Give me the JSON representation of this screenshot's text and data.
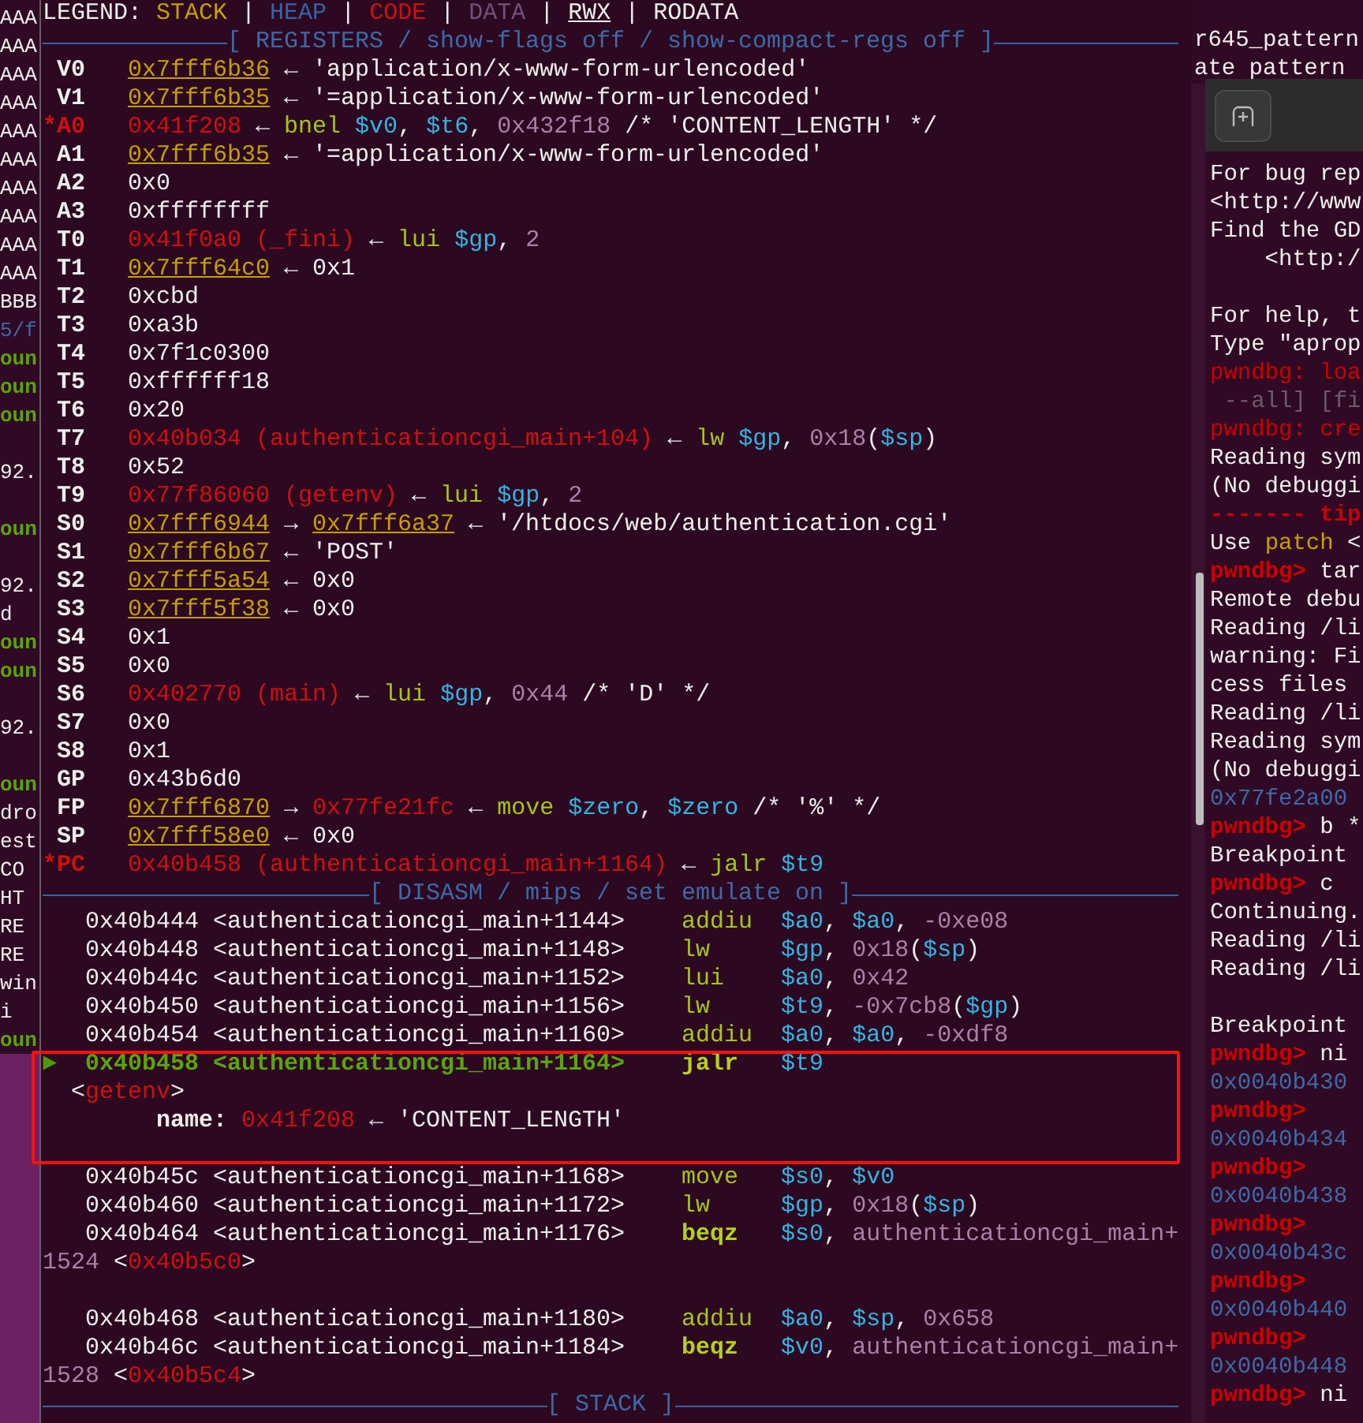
{
  "left_pane": {
    "lines": [
      {
        "text": "AAA",
        "kind": "plain"
      },
      {
        "text": "AAA",
        "kind": "plain"
      },
      {
        "text": "AAA",
        "kind": "plain"
      },
      {
        "text": "AAA",
        "kind": "plain"
      },
      {
        "text": "AAA",
        "kind": "plain"
      },
      {
        "text": "AAA",
        "kind": "plain"
      },
      {
        "text": "AAA",
        "kind": "plain"
      },
      {
        "text": "AAA",
        "kind": "plain"
      },
      {
        "text": "AAA",
        "kind": "plain"
      },
      {
        "text": "AAA",
        "kind": "plain"
      },
      {
        "text": "BBB",
        "kind": "plain"
      },
      {
        "text": "5/f",
        "kind": "blue"
      },
      {
        "text": "oun",
        "kind": "green"
      },
      {
        "text": "oun",
        "kind": "green"
      },
      {
        "text": "oun",
        "kind": "green"
      },
      {
        "kind": "blank"
      },
      {
        "text": "92.",
        "kind": "plain"
      },
      {
        "kind": "blank"
      },
      {
        "text": "oun",
        "kind": "green"
      },
      {
        "kind": "blank"
      },
      {
        "text": "92.",
        "kind": "plain"
      },
      {
        "text": "d",
        "kind": "plain"
      },
      {
        "text": "oun",
        "kind": "green"
      },
      {
        "text": "oun",
        "kind": "green"
      },
      {
        "kind": "blank"
      },
      {
        "text": "92.",
        "kind": "plain"
      },
      {
        "kind": "blank"
      },
      {
        "text": "oun",
        "kind": "green"
      },
      {
        "text": "dro",
        "kind": "plain"
      },
      {
        "text": "est",
        "kind": "plain"
      },
      {
        "text": "CO",
        "kind": "plain"
      },
      {
        "text": "HT",
        "kind": "plain"
      },
      {
        "text": "RE",
        "kind": "plain"
      },
      {
        "text": "RE",
        "kind": "plain"
      },
      {
        "text": "win",
        "kind": "plain"
      },
      {
        "text": "i",
        "kind": "plain"
      },
      {
        "text": "oun",
        "kind": "green"
      }
    ]
  },
  "main_pane": {
    "legend": [
      {
        "text": "LEGEND: ",
        "kind": "plain"
      },
      {
        "text": "STACK",
        "kind": "stack-label"
      },
      {
        "text": " | ",
        "kind": "plain"
      },
      {
        "text": "HEAP",
        "kind": "heap"
      },
      {
        "text": " | ",
        "kind": "plain"
      },
      {
        "text": "CODE",
        "kind": "code"
      },
      {
        "text": " | ",
        "kind": "plain"
      },
      {
        "text": "DATA",
        "kind": "data"
      },
      {
        "text": " | ",
        "kind": "plain"
      },
      {
        "text": "RWX",
        "kind": "rwx"
      },
      {
        "text": " | ",
        "kind": "plain"
      },
      {
        "text": "RODATA",
        "kind": "plain"
      }
    ],
    "registers": {
      "title": "[ REGISTERS / show-flags off / show-compact-regs off ]",
      "rows": [
        {
          "name": "V0",
          "changed": false,
          "value": [
            {
              "text": "0x7fff6b36",
              "kind": "stack"
            },
            {
              "text": " ← 'application/x-www-form-urlencoded'",
              "kind": "plain"
            }
          ]
        },
        {
          "name": "V1",
          "changed": false,
          "value": [
            {
              "text": "0x7fff6b35",
              "kind": "stack"
            },
            {
              "text": " ← '=application/x-www-form-urlencoded'",
              "kind": "plain"
            }
          ]
        },
        {
          "name": "*A0",
          "changed": true,
          "value": [
            {
              "text": "0x41f208",
              "kind": "code"
            },
            {
              "text": " ← ",
              "kind": "plain"
            },
            {
              "text": "bnel",
              "kind": "mnem"
            },
            {
              "text": " $v0",
              "kind": "reg"
            },
            {
              "text": ", ",
              "kind": "plain"
            },
            {
              "text": "$t6",
              "kind": "reg"
            },
            {
              "text": ", ",
              "kind": "plain"
            },
            {
              "text": "0x432f18",
              "kind": "num"
            },
            {
              "text": " /* 'CONTENT_LENGTH' */",
              "kind": "plain"
            }
          ]
        },
        {
          "name": "A1",
          "changed": false,
          "value": [
            {
              "text": "0x7fff6b35",
              "kind": "stack"
            },
            {
              "text": " ← '=application/x-www-form-urlencoded'",
              "kind": "plain"
            }
          ]
        },
        {
          "name": "A2",
          "changed": false,
          "value": [
            {
              "text": "0x0",
              "kind": "plain"
            }
          ]
        },
        {
          "name": "A3",
          "changed": false,
          "value": [
            {
              "text": "0xffffffff",
              "kind": "plain"
            }
          ]
        },
        {
          "name": "T0",
          "changed": false,
          "value": [
            {
              "text": "0x41f0a0 (_fini)",
              "kind": "code"
            },
            {
              "text": " ← ",
              "kind": "plain"
            },
            {
              "text": "lui",
              "kind": "mnem"
            },
            {
              "text": " $gp",
              "kind": "reg"
            },
            {
              "text": ", ",
              "kind": "plain"
            },
            {
              "text": "2",
              "kind": "num"
            }
          ]
        },
        {
          "name": "T1",
          "changed": false,
          "value": [
            {
              "text": "0x7fff64c0",
              "kind": "stack"
            },
            {
              "text": " ← 0x1",
              "kind": "plain"
            }
          ]
        },
        {
          "name": "T2",
          "changed": false,
          "value": [
            {
              "text": "0xcbd",
              "kind": "plain"
            }
          ]
        },
        {
          "name": "T3",
          "changed": false,
          "value": [
            {
              "text": "0xa3b",
              "kind": "plain"
            }
          ]
        },
        {
          "name": "T4",
          "changed": false,
          "value": [
            {
              "text": "0x7f1c0300",
              "kind": "plain"
            }
          ]
        },
        {
          "name": "T5",
          "changed": false,
          "value": [
            {
              "text": "0xffffff18",
              "kind": "plain"
            }
          ]
        },
        {
          "name": "T6",
          "changed": false,
          "value": [
            {
              "text": "0x20",
              "kind": "plain"
            }
          ]
        },
        {
          "name": "T7",
          "changed": false,
          "value": [
            {
              "text": "0x40b034 (authenticationcgi_main+104)",
              "kind": "code"
            },
            {
              "text": " ← ",
              "kind": "plain"
            },
            {
              "text": "lw",
              "kind": "mnem"
            },
            {
              "text": " $gp",
              "kind": "reg"
            },
            {
              "text": ", ",
              "kind": "plain"
            },
            {
              "text": "0x18",
              "kind": "num"
            },
            {
              "text": "(",
              "kind": "plain"
            },
            {
              "text": "$sp",
              "kind": "reg"
            },
            {
              "text": ")",
              "kind": "plain"
            }
          ]
        },
        {
          "name": "T8",
          "changed": false,
          "value": [
            {
              "text": "0x52",
              "kind": "plain"
            }
          ]
        },
        {
          "name": "T9",
          "changed": false,
          "value": [
            {
              "text": "0x77f86060 (getenv)",
              "kind": "code"
            },
            {
              "text": " ← ",
              "kind": "plain"
            },
            {
              "text": "lui",
              "kind": "mnem"
            },
            {
              "text": " $gp",
              "kind": "reg"
            },
            {
              "text": ", ",
              "kind": "plain"
            },
            {
              "text": "2",
              "kind": "num"
            }
          ]
        },
        {
          "name": "S0",
          "changed": false,
          "value": [
            {
              "text": "0x7fff6944",
              "kind": "stack"
            },
            {
              "text": " → ",
              "kind": "plain"
            },
            {
              "text": "0x7fff6a37",
              "kind": "stack"
            },
            {
              "text": " ← '/htdocs/web/authentication.cgi'",
              "kind": "plain"
            }
          ]
        },
        {
          "name": "S1",
          "changed": false,
          "value": [
            {
              "text": "0x7fff6b67",
              "kind": "stack"
            },
            {
              "text": " ← 'POST'",
              "kind": "plain"
            }
          ]
        },
        {
          "name": "S2",
          "changed": false,
          "value": [
            {
              "text": "0x7fff5a54",
              "kind": "stack"
            },
            {
              "text": " ← 0x0",
              "kind": "plain"
            }
          ]
        },
        {
          "name": "S3",
          "changed": false,
          "value": [
            {
              "text": "0x7fff5f38",
              "kind": "stack"
            },
            {
              "text": " ← 0x0",
              "kind": "plain"
            }
          ]
        },
        {
          "name": "S4",
          "changed": false,
          "value": [
            {
              "text": "0x1",
              "kind": "plain"
            }
          ]
        },
        {
          "name": "S5",
          "changed": false,
          "value": [
            {
              "text": "0x0",
              "kind": "plain"
            }
          ]
        },
        {
          "name": "S6",
          "changed": false,
          "value": [
            {
              "text": "0x402770 (main)",
              "kind": "code"
            },
            {
              "text": " ← ",
              "kind": "plain"
            },
            {
              "text": "lui",
              "kind": "mnem"
            },
            {
              "text": " $gp",
              "kind": "reg"
            },
            {
              "text": ", ",
              "kind": "plain"
            },
            {
              "text": "0x44",
              "kind": "num"
            },
            {
              "text": " /* 'D' */",
              "kind": "plain"
            }
          ]
        },
        {
          "name": "S7",
          "changed": false,
          "value": [
            {
              "text": "0x0",
              "kind": "plain"
            }
          ]
        },
        {
          "name": "S8",
          "changed": false,
          "value": [
            {
              "text": "0x1",
              "kind": "plain"
            }
          ]
        },
        {
          "name": "GP",
          "changed": false,
          "value": [
            {
              "text": "0x43b6d0",
              "kind": "plain"
            }
          ]
        },
        {
          "name": "FP",
          "changed": false,
          "value": [
            {
              "text": "0x7fff6870",
              "kind": "stack"
            },
            {
              "text": " → ",
              "kind": "plain"
            },
            {
              "text": "0x77fe21fc",
              "kind": "code"
            },
            {
              "text": " ← ",
              "kind": "plain"
            },
            {
              "text": "move",
              "kind": "mnem"
            },
            {
              "text": " $zero",
              "kind": "reg"
            },
            {
              "text": ", ",
              "kind": "plain"
            },
            {
              "text": "$zero",
              "kind": "reg"
            },
            {
              "text": " /* '%' */",
              "kind": "plain"
            }
          ]
        },
        {
          "name": "SP",
          "changed": false,
          "value": [
            {
              "text": "0x7fff58e0",
              "kind": "stack"
            },
            {
              "text": " ← 0x0",
              "kind": "plain"
            }
          ]
        },
        {
          "name": "*PC",
          "changed": true,
          "value": [
            {
              "text": "0x40b458 (authenticationcgi_main+1164)",
              "kind": "code"
            },
            {
              "text": " ← ",
              "kind": "plain"
            },
            {
              "text": "jalr",
              "kind": "mnem"
            },
            {
              "text": " $t9",
              "kind": "reg"
            }
          ]
        }
      ]
    },
    "disasm": {
      "title": "[ DISASM / mips / set emulate on ]",
      "lines": [
        {
          "kind": "instruction",
          "current": false,
          "address": "0x40b444 <authenticationcgi_main+1144>",
          "mnemonic": {
            "text": "addiu",
            "kind": "mnem"
          },
          "operands": [
            {
              "text": "$a0",
              "kind": "reg"
            },
            {
              "text": ", ",
              "kind": "plain"
            },
            {
              "text": "$a0",
              "kind": "reg"
            },
            {
              "text": ", ",
              "kind": "plain"
            },
            {
              "text": "-0xe08",
              "kind": "num"
            }
          ]
        },
        {
          "kind": "instruction",
          "current": false,
          "address": "0x40b448 <authenticationcgi_main+1148>",
          "mnemonic": {
            "text": "lw",
            "kind": "mnem"
          },
          "operands": [
            {
              "text": "$gp",
              "kind": "reg"
            },
            {
              "text": ", ",
              "kind": "plain"
            },
            {
              "text": "0x18",
              "kind": "num"
            },
            {
              "text": "(",
              "kind": "plain"
            },
            {
              "text": "$sp",
              "kind": "reg"
            },
            {
              "text": ")",
              "kind": "plain"
            }
          ]
        },
        {
          "kind": "instruction",
          "current": false,
          "address": "0x40b44c <authenticationcgi_main+1152>",
          "mnemonic": {
            "text": "lui",
            "kind": "mnem"
          },
          "operands": [
            {
              "text": "$a0",
              "kind": "reg"
            },
            {
              "text": ", ",
              "kind": "plain"
            },
            {
              "text": "0x42",
              "kind": "num"
            }
          ]
        },
        {
          "kind": "instruction",
          "current": false,
          "address": "0x40b450 <authenticationcgi_main+1156>",
          "mnemonic": {
            "text": "lw",
            "kind": "mnem"
          },
          "operands": [
            {
              "text": "$t9",
              "kind": "reg"
            },
            {
              "text": ", ",
              "kind": "plain"
            },
            {
              "text": "-0x7cb8",
              "kind": "num"
            },
            {
              "text": "(",
              "kind": "plain"
            },
            {
              "text": "$gp",
              "kind": "reg"
            },
            {
              "text": ")",
              "kind": "plain"
            }
          ]
        },
        {
          "kind": "instruction",
          "current": false,
          "address": "0x40b454 <authenticationcgi_main+1160>",
          "mnemonic": {
            "text": "addiu",
            "kind": "mnem"
          },
          "operands": [
            {
              "text": "$a0",
              "kind": "reg"
            },
            {
              "text": ", ",
              "kind": "plain"
            },
            {
              "text": "$a0",
              "kind": "reg"
            },
            {
              "text": ", ",
              "kind": "plain"
            },
            {
              "text": "-0xdf8",
              "kind": "num"
            }
          ]
        },
        {
          "kind": "instruction",
          "current": true,
          "marker": "►",
          "address": "0x40b458 <authenticationcgi_main+1164>",
          "mnemonic": {
            "text": "jalr",
            "kind": "branch"
          },
          "operands": [
            {
              "text": "$t9",
              "kind": "reg"
            }
          ]
        },
        {
          "kind": "call",
          "spans": [
            {
              "text": "<",
              "kind": "plain"
            },
            {
              "text": "getenv",
              "kind": "code"
            },
            {
              "text": ">",
              "kind": "plain"
            }
          ]
        },
        {
          "kind": "argument",
          "spans": [
            {
              "text": "name:",
              "kind": "bold"
            },
            {
              "text": " 0x41f208",
              "kind": "code"
            },
            {
              "text": " ← 'CONTENT_LENGTH'",
              "kind": "plain"
            }
          ]
        },
        {
          "kind": "blank"
        },
        {
          "kind": "instruction",
          "current": false,
          "address": "0x40b45c <authenticationcgi_main+1168>",
          "mnemonic": {
            "text": "move",
            "kind": "mnem"
          },
          "operands": [
            {
              "text": "$s0",
              "kind": "reg"
            },
            {
              "text": ", ",
              "kind": "plain"
            },
            {
              "text": "$v0",
              "kind": "reg"
            }
          ]
        },
        {
          "kind": "instruction",
          "current": false,
          "address": "0x40b460 <authenticationcgi_main+1172>",
          "mnemonic": {
            "text": "lw",
            "kind": "mnem"
          },
          "operands": [
            {
              "text": "$gp",
              "kind": "reg"
            },
            {
              "text": ", ",
              "kind": "plain"
            },
            {
              "text": "0x18",
              "kind": "num"
            },
            {
              "text": "(",
              "kind": "plain"
            },
            {
              "text": "$sp",
              "kind": "reg"
            },
            {
              "text": ")",
              "kind": "plain"
            }
          ]
        },
        {
          "kind": "instruction",
          "current": false,
          "address": "0x40b464 <authenticationcgi_main+1176>",
          "mnemonic": {
            "text": "beqz",
            "kind": "branch"
          },
          "operands": [
            {
              "text": "$s0",
              "kind": "reg"
            },
            {
              "text": ", ",
              "kind": "plain"
            },
            {
              "text": "authenticationcgi_main+",
              "kind": "num"
            }
          ]
        },
        {
          "kind": "continuation",
          "spans": [
            {
              "text": "1524",
              "kind": "num"
            },
            {
              "text": " <",
              "kind": "plain"
            },
            {
              "text": "0x40b5c0",
              "kind": "code"
            },
            {
              "text": ">",
              "kind": "plain"
            }
          ]
        },
        {
          "kind": "blank"
        },
        {
          "kind": "instruction",
          "current": false,
          "address": "0x40b468 <authenticationcgi_main+1180>",
          "mnemonic": {
            "text": "addiu",
            "kind": "mnem"
          },
          "operands": [
            {
              "text": "$a0",
              "kind": "reg"
            },
            {
              "text": ", ",
              "kind": "plain"
            },
            {
              "text": "$sp",
              "kind": "reg"
            },
            {
              "text": ", ",
              "kind": "plain"
            },
            {
              "text": "0x658",
              "kind": "num"
            }
          ]
        },
        {
          "kind": "instruction",
          "current": false,
          "address": "0x40b46c <authenticationcgi_main+1184>",
          "mnemonic": {
            "text": "beqz",
            "kind": "branch"
          },
          "operands": [
            {
              "text": "$v0",
              "kind": "reg"
            },
            {
              "text": ", ",
              "kind": "plain"
            },
            {
              "text": "authenticationcgi_main+",
              "kind": "num"
            }
          ]
        },
        {
          "kind": "continuation",
          "spans": [
            {
              "text": "1528",
              "kind": "num"
            },
            {
              "text": " <",
              "kind": "plain"
            },
            {
              "text": "0x40b5c4",
              "kind": "code"
            },
            {
              "text": ">",
              "kind": "plain"
            }
          ]
        }
      ]
    },
    "stack": {
      "title": "[ STACK ]"
    }
  },
  "right_pane": {
    "background_lines": [
      "r645_pattern",
      "ate pattern"
    ],
    "gdb_window": {
      "lines": [
        {
          "kind": "text",
          "spans": [
            {
              "text": "For bug rep",
              "kind": "plain"
            }
          ]
        },
        {
          "kind": "text",
          "spans": [
            {
              "text": "<http://www",
              "kind": "plain"
            }
          ]
        },
        {
          "kind": "text",
          "spans": [
            {
              "text": "Find the GD",
              "kind": "plain"
            }
          ]
        },
        {
          "kind": "indented",
          "spans": [
            {
              "text": "<http:/",
              "kind": "plain"
            }
          ]
        },
        {
          "kind": "blank"
        },
        {
          "kind": "text",
          "spans": [
            {
              "text": "For help, t",
              "kind": "plain"
            }
          ]
        },
        {
          "kind": "text",
          "spans": [
            {
              "text": "Type \"aprop",
              "kind": "plain"
            }
          ]
        },
        {
          "kind": "text",
          "spans": [
            {
              "text": "pwndbg: loa",
              "kind": "red"
            }
          ]
        },
        {
          "kind": "text",
          "spans": [
            {
              "text": " --all] [fi",
              "kind": "grey"
            }
          ]
        },
        {
          "kind": "text",
          "spans": [
            {
              "text": "pwndbg: cre",
              "kind": "red"
            }
          ]
        },
        {
          "kind": "text",
          "spans": [
            {
              "text": "Reading sym",
              "kind": "plain"
            }
          ]
        },
        {
          "kind": "text",
          "spans": [
            {
              "text": "(No debuggi",
              "kind": "plain"
            }
          ]
        },
        {
          "kind": "text",
          "spans": [
            {
              "text": "------- tip",
              "kind": "prompt"
            }
          ]
        },
        {
          "kind": "text",
          "spans": [
            {
              "text": "Use ",
              "kind": "plain"
            },
            {
              "text": "patch",
              "kind": "yellow"
            },
            {
              "text": " <",
              "kind": "plain"
            }
          ]
        },
        {
          "kind": "text",
          "spans": [
            {
              "text": "pwndbg>",
              "kind": "prompt"
            },
            {
              "text": " tar",
              "kind": "plain"
            }
          ]
        },
        {
          "kind": "text",
          "spans": [
            {
              "text": "Remote debu",
              "kind": "plain"
            }
          ]
        },
        {
          "kind": "text",
          "spans": [
            {
              "text": "Reading /li",
              "kind": "plain"
            }
          ]
        },
        {
          "kind": "text",
          "spans": [
            {
              "text": "warning: Fi",
              "kind": "plain"
            }
          ]
        },
        {
          "kind": "text",
          "spans": [
            {
              "text": "cess files",
              "kind": "plain"
            }
          ]
        },
        {
          "kind": "text",
          "spans": [
            {
              "text": "Reading /li",
              "kind": "plain"
            }
          ]
        },
        {
          "kind": "text",
          "spans": [
            {
              "text": "Reading sym",
              "kind": "plain"
            }
          ]
        },
        {
          "kind": "text",
          "spans": [
            {
              "text": "(No debuggi",
              "kind": "plain"
            }
          ]
        },
        {
          "kind": "text",
          "spans": [
            {
              "text": "0x77fe2a00",
              "kind": "blue"
            }
          ]
        },
        {
          "kind": "text",
          "spans": [
            {
              "text": "pwndbg>",
              "kind": "prompt"
            },
            {
              "text": " b *",
              "kind": "plain"
            }
          ]
        },
        {
          "kind": "text",
          "spans": [
            {
              "text": "Breakpoint",
              "kind": "plain"
            }
          ]
        },
        {
          "kind": "text",
          "spans": [
            {
              "text": "pwndbg>",
              "kind": "prompt"
            },
            {
              "text": " c",
              "kind": "plain"
            }
          ]
        },
        {
          "kind": "text",
          "spans": [
            {
              "text": "Continuing.",
              "kind": "plain"
            }
          ]
        },
        {
          "kind": "text",
          "spans": [
            {
              "text": "Reading /li",
              "kind": "plain"
            }
          ]
        },
        {
          "kind": "text",
          "spans": [
            {
              "text": "Reading /li",
              "kind": "plain"
            }
          ]
        },
        {
          "kind": "blank"
        },
        {
          "kind": "text",
          "spans": [
            {
              "text": "Breakpoint",
              "kind": "plain"
            }
          ]
        },
        {
          "kind": "text",
          "spans": [
            {
              "text": "pwndbg>",
              "kind": "prompt"
            },
            {
              "text": " ni",
              "kind": "plain"
            }
          ]
        },
        {
          "kind": "text",
          "spans": [
            {
              "text": "0x0040b430",
              "kind": "blue"
            }
          ]
        },
        {
          "kind": "text",
          "spans": [
            {
              "text": "pwndbg>",
              "kind": "prompt"
            }
          ]
        },
        {
          "kind": "text",
          "spans": [
            {
              "text": "0x0040b434",
              "kind": "blue"
            }
          ]
        },
        {
          "kind": "text",
          "spans": [
            {
              "text": "pwndbg>",
              "kind": "prompt"
            }
          ]
        },
        {
          "kind": "text",
          "spans": [
            {
              "text": "0x0040b438",
              "kind": "blue"
            }
          ]
        },
        {
          "kind": "text",
          "spans": [
            {
              "text": "pwndbg>",
              "kind": "prompt"
            }
          ]
        },
        {
          "kind": "text",
          "spans": [
            {
              "text": "0x0040b43c",
              "kind": "blue"
            }
          ]
        },
        {
          "kind": "text",
          "spans": [
            {
              "text": "pwndbg>",
              "kind": "prompt"
            }
          ]
        },
        {
          "kind": "text",
          "spans": [
            {
              "text": "0x0040b440",
              "kind": "blue"
            }
          ]
        },
        {
          "kind": "text",
          "spans": [
            {
              "text": "pwndbg>",
              "kind": "prompt"
            }
          ]
        },
        {
          "kind": "text",
          "spans": [
            {
              "text": "0x0040b448",
              "kind": "blue"
            }
          ]
        },
        {
          "kind": "text",
          "spans": [
            {
              "text": "pwndbg>",
              "kind": "prompt"
            },
            {
              "text": " ni",
              "kind": "plain"
            }
          ]
        }
      ]
    }
  }
}
